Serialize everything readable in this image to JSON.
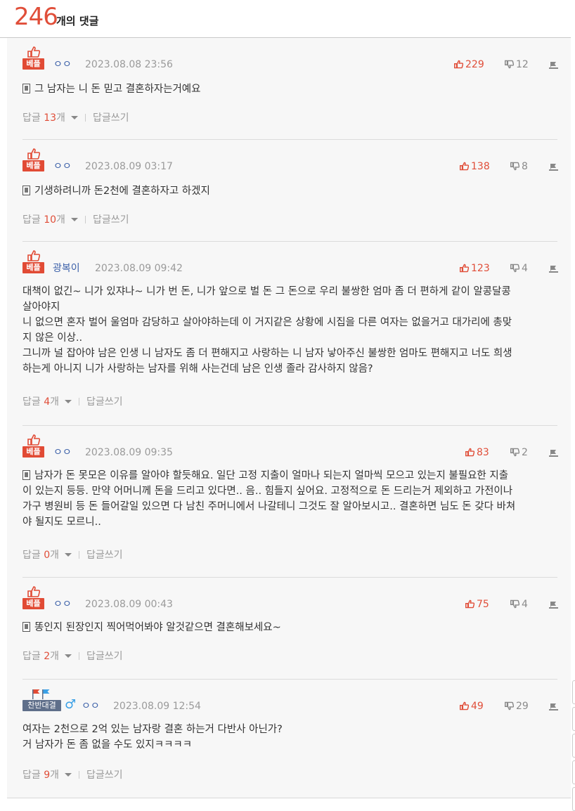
{
  "header": {
    "count": "246",
    "count_label": "개의 댓글"
  },
  "comments": [
    {
      "badge": "베플",
      "author": "ㅇㅇ",
      "date": "2023.08.08 23:56",
      "likes": "229",
      "dislikes": "12",
      "has_mobile": true,
      "lines": [
        "그 남자는 니 돈 믿고 결혼하자는거예요"
      ],
      "reply_prefix": "답글 ",
      "reply_count": "13",
      "reply_suffix": "개",
      "write_label": "답글쓰기"
    },
    {
      "badge": "베플",
      "author": "ㅇㅇ",
      "date": "2023.08.09 03:17",
      "likes": "138",
      "dislikes": "8",
      "has_mobile": true,
      "lines": [
        "기생하려니까 돈2천에 결혼하자고 하겠지"
      ],
      "reply_prefix": "답글 ",
      "reply_count": "10",
      "reply_suffix": "개",
      "write_label": "답글쓰기"
    },
    {
      "badge": "베플",
      "author": "광복이",
      "date": "2023.08.09 09:42",
      "likes": "123",
      "dislikes": "4",
      "has_mobile": false,
      "lines": [
        "대책이 없긴~ 니가 있쟈나~ 니가 번 돈, 니가 앞으로 벌 돈 그 돈으로 우리 불쌍한 엄마 좀 더 편하게 같이 알콩달콩",
        "살아야지",
        "니 없으면 혼자 벌어 울엄마 감당하고 살아야하는데 이 거지같은 상황에 시집을 다른 여자는 없을거고 대가리에 총맞",
        "지 않은 이상..",
        "그니까 널 잡아야 남은 인생 니 남자도 좀 더 편해지고 사랑하는 니 남자 낳아주신 불쌍한 엄마도 편해지고 너도 희생",
        "하는게 아니지 니가 사랑하는 남자를 위해 사는건데 남은 인생 졸라 감사하지 않음?"
      ],
      "reply_prefix": "답글 ",
      "reply_count": "4",
      "reply_suffix": "개",
      "write_label": "답글쓰기"
    },
    {
      "badge": "베플",
      "author": "ㅇㅇ",
      "date": "2023.08.09 09:35",
      "likes": "83",
      "dislikes": "2",
      "has_mobile": true,
      "lines": [
        "남자가 돈 못모은 이유를 알아야 할듯해요. 일단 고정 지출이 얼마나 되는지 얼마씩 모으고 있는지 불필요한 지출",
        "이 있는지 등등. 만약 어머니께 돈을 드리고 있다면.. 음.. 힘들지 싶어요. 고정적으로 돈 드리는거 제외하고 가전이나",
        "가구 병원비 등 돈 들어갈일 있으면 다 남친 주머니에서 나갈테니 그것도 잘 알아보시고.. 결혼하면 님도 돈 갖다 바쳐",
        "야 될지도 모르니.."
      ],
      "reply_prefix": "답글 ",
      "reply_count": "0",
      "reply_suffix": "개",
      "write_label": "답글쓰기"
    },
    {
      "badge": "베플",
      "author": "ㅇㅇ",
      "date": "2023.08.09 00:43",
      "likes": "75",
      "dislikes": "4",
      "has_mobile": true,
      "lines": [
        "똥인지 된장인지 찍어먹어봐야 알것같으면 결혼해보세요~"
      ],
      "reply_prefix": "답글 ",
      "reply_count": "2",
      "reply_suffix": "개",
      "write_label": "답글쓰기"
    },
    {
      "badge": "찬반대결",
      "author": "ㅇㅇ",
      "date": "2023.08.09 12:54",
      "likes": "49",
      "dislikes": "29",
      "has_mobile": false,
      "lines": [
        "여자는 2천으로 2억 있는 남자랑 결혼 하는거 다반사 아닌가?",
        "거 남자가 돈 좀 없을 수도 있지ㅋㅋㅋㅋ"
      ],
      "reply_prefix": "답글 ",
      "reply_count": "9",
      "reply_suffix": "개",
      "write_label": "답글쓰기"
    }
  ],
  "colors": {
    "accent": "#e04e39",
    "author": "#3a5fa8",
    "muted": "#9a9a9a",
    "vs_badge": "#5f6f8a"
  }
}
